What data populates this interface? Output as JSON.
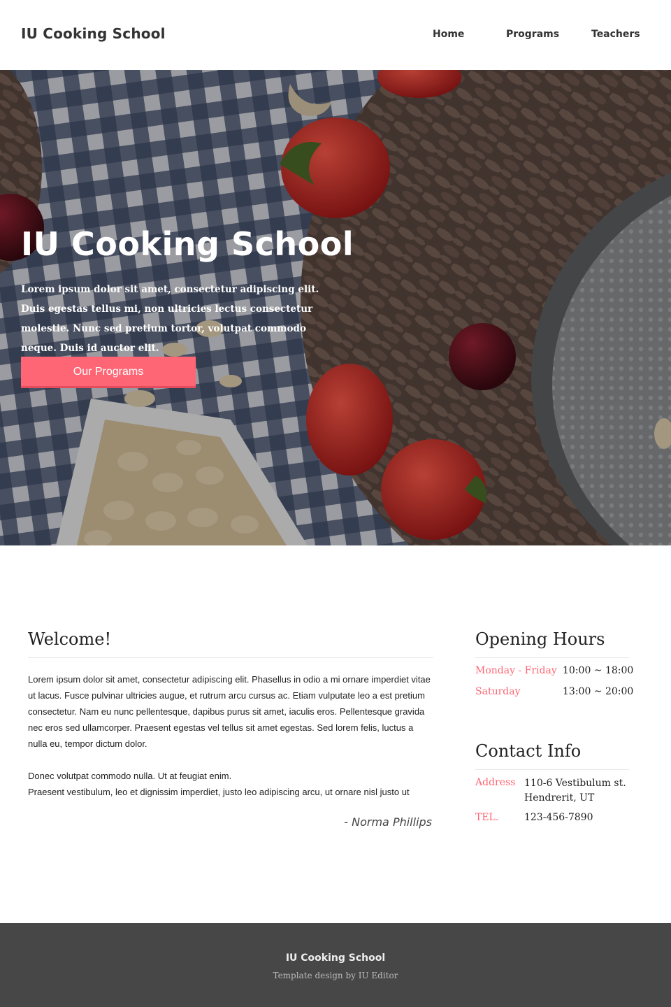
{
  "header": {
    "logo": "IU Cooking School",
    "nav": [
      "Home",
      "Programs",
      "Teachers"
    ]
  },
  "hero": {
    "title": "IU Cooking School",
    "text": "Lorem ipsum dolor sit amet, consectetur adipiscing elit. Duis egestas tellus mi, non ultricies lectus consectetur molestie. Nunc sed pretium tortor, volutpat commodo neque. Duis id auctor elit.",
    "button": "Our Programs"
  },
  "welcome": {
    "title": "Welcome!",
    "paragraph1": "Lorem ipsum dolor sit amet, consectetur adipiscing elit. Phasellus in odio a mi ornare imperdiet vitae ut lacus. Fusce pulvinar ultricies augue, et rutrum arcu cursus ac. Etiam vulputate leo a est pretium consectetur. Nam eu nunc pellentesque, dapibus purus sit amet, iaculis eros. Pellentesque gravida nec eros sed ullamcorper. Praesent egestas vel tellus sit amet egestas. Sed lorem felis, luctus a nulla eu, tempor dictum dolor.",
    "paragraph2_line1": "Donec volutpat commodo nulla. Ut at feugiat enim.",
    "paragraph2_line2": "Praesent vestibulum, leo et dignissim imperdiet, justo leo adipiscing arcu, ut ornare nisl justo ut",
    "signature": "- Norma Phillips"
  },
  "hours": {
    "title": "Opening Hours",
    "rows": [
      {
        "day": "Monday - Friday",
        "time": "10:00 ~ 18:00"
      },
      {
        "day": "Saturday",
        "time": "13:00 ~ 20:00"
      }
    ]
  },
  "contact": {
    "title": "Contact Info",
    "address_label": "Address",
    "address_line1": "110-6 Vestibulum st.",
    "address_line2": "Hendrerit, UT",
    "tel_label": "TEL.",
    "tel": "123-456-7890"
  },
  "footer": {
    "title": "IU Cooking School",
    "subtitle": "Template design by IU Editor"
  },
  "colors": {
    "accent": "#ff6675",
    "footer_bg": "#474747"
  }
}
